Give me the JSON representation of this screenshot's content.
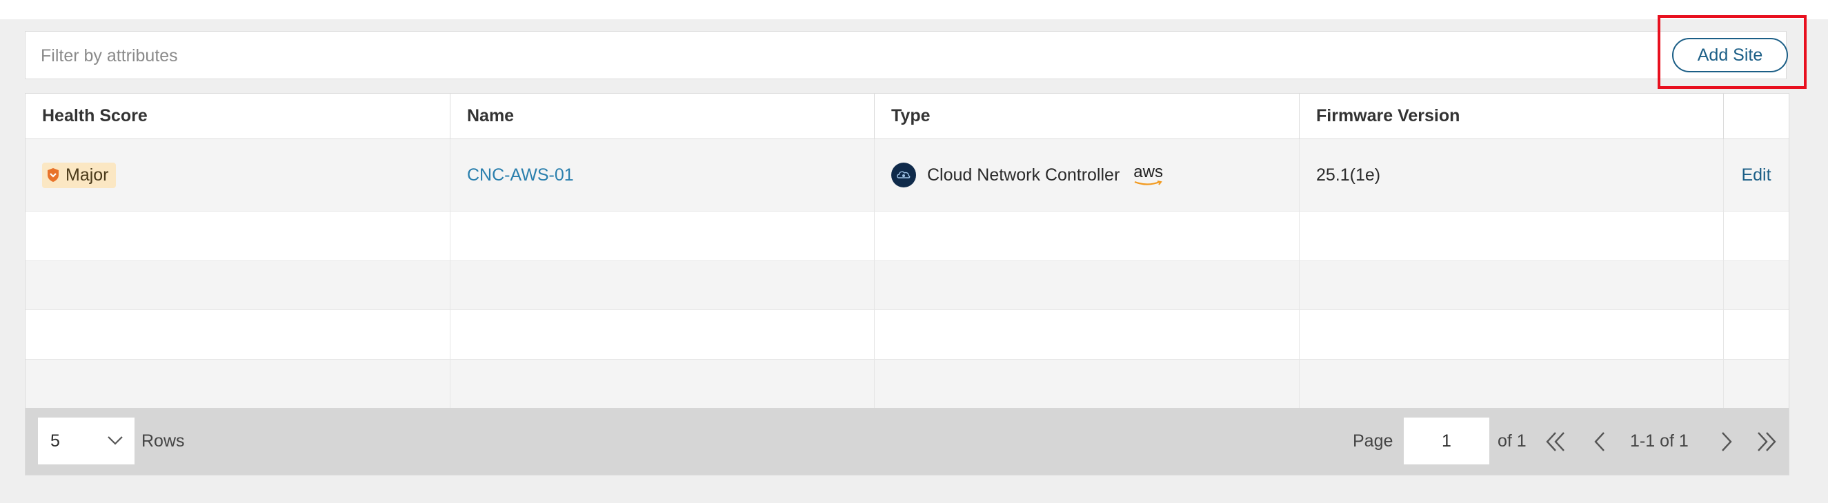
{
  "filter": {
    "placeholder": "Filter by attributes"
  },
  "toolbar": {
    "add_site_label": "Add Site"
  },
  "table": {
    "columns": [
      "Health Score",
      "Name",
      "Type",
      "Firmware Version"
    ],
    "rows": [
      {
        "health": "Major",
        "name": "CNC-AWS-01",
        "type": "Cloud Network Controller",
        "cloud_provider": "aws",
        "firmware": "25.1(1e)",
        "action": "Edit"
      }
    ]
  },
  "pager": {
    "rows_value": "5",
    "rows_label": "Rows",
    "page_label": "Page",
    "page_value": "1",
    "of_label": "of  1",
    "range_label": "1-1 of 1"
  },
  "colors": {
    "accent": "#1b5e86",
    "link": "#2a7fad",
    "highlight": "#e8101f",
    "major": "#fbe7c3"
  }
}
